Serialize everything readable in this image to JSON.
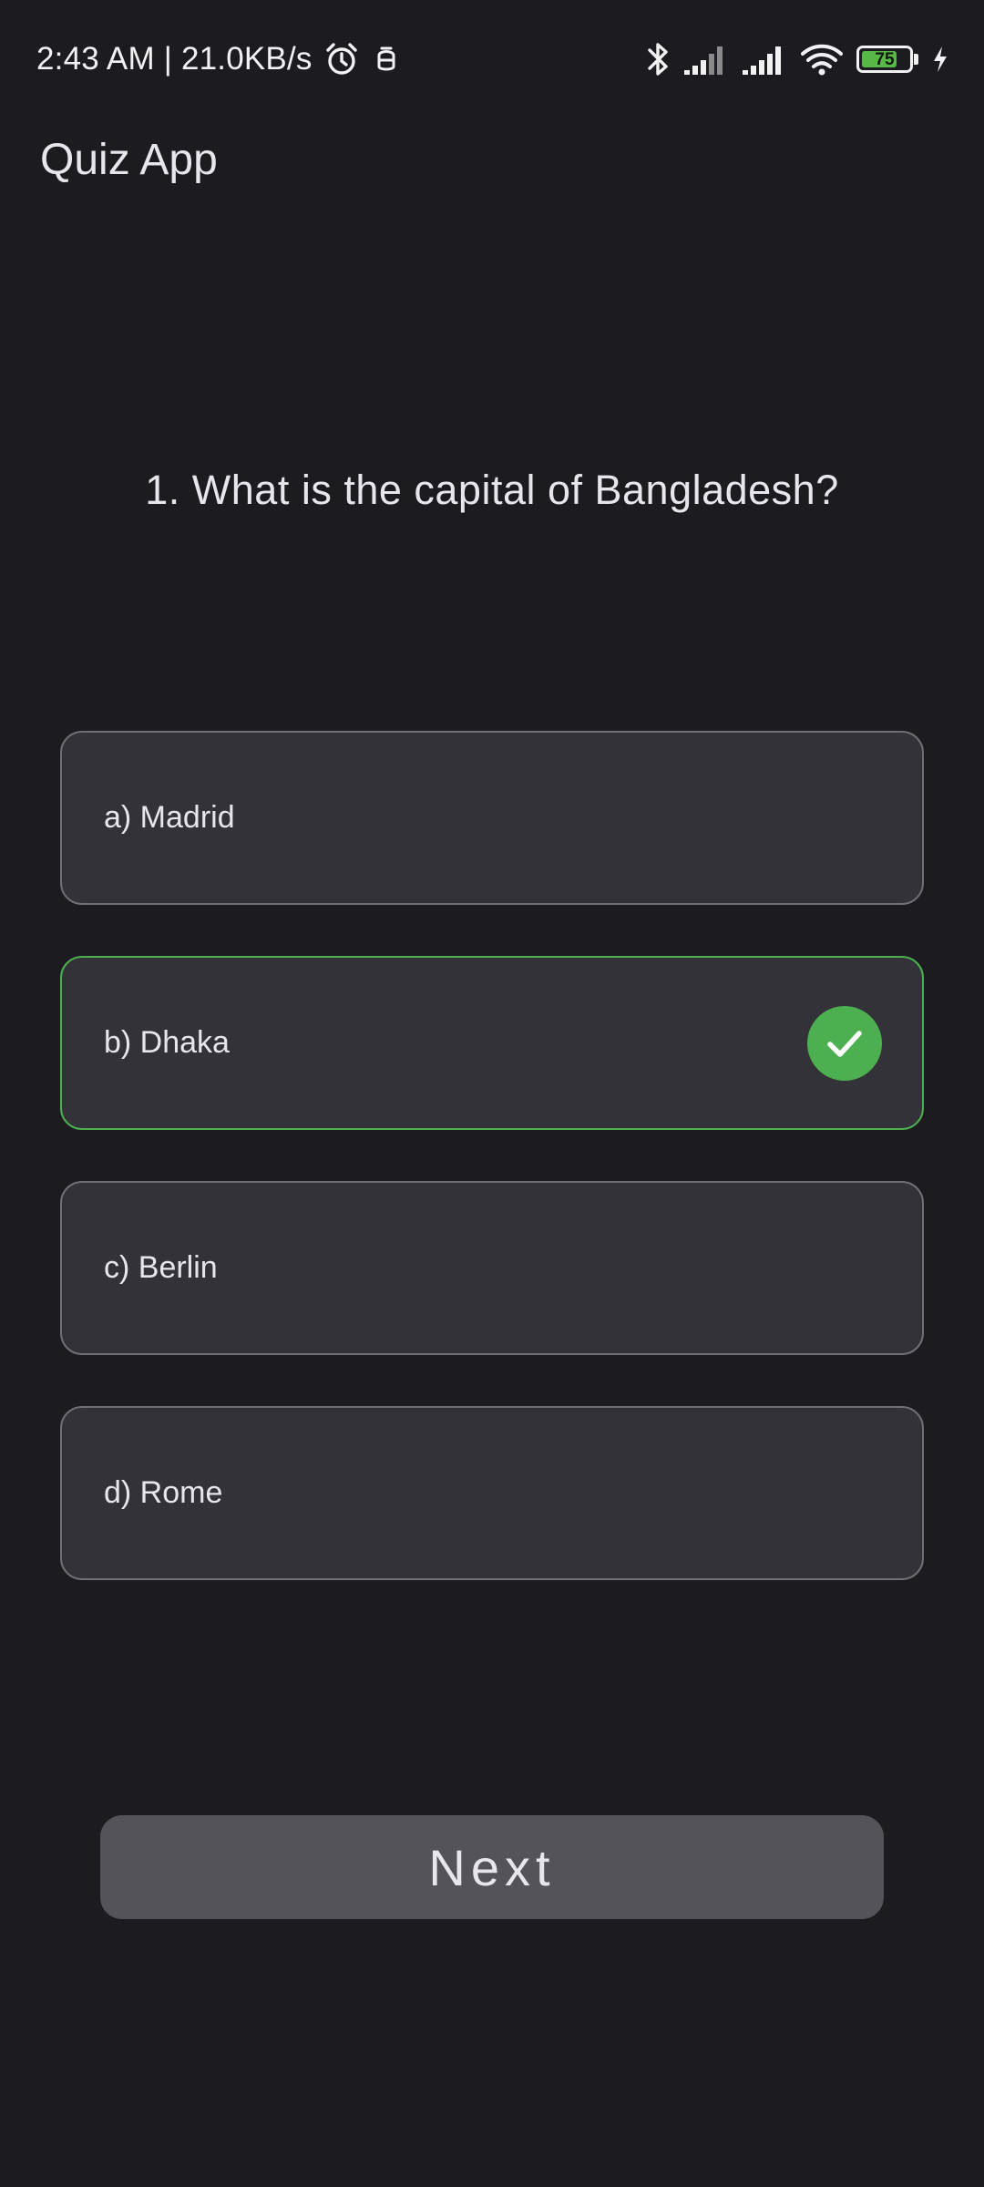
{
  "status_bar": {
    "text": "2:43 AM | 21.0KB/s",
    "battery_level": "75",
    "battery_fraction": 0.75,
    "icons_left": [
      "alarm-icon",
      "notification-icon"
    ],
    "icons_right": [
      "bluetooth-icon",
      "signal-icon",
      "signal-icon",
      "wifi-icon",
      "battery-icon",
      "charging-icon"
    ]
  },
  "app_bar": {
    "title": "Quiz App"
  },
  "quiz": {
    "question": "1. What is the capital of Bangladesh?",
    "options": [
      {
        "label": "a) Madrid",
        "selected": false
      },
      {
        "label": "b) Dhaka",
        "selected": true
      },
      {
        "label": "c) Berlin",
        "selected": false
      },
      {
        "label": "d) Rome",
        "selected": false
      }
    ],
    "next_label": "Next"
  },
  "colors": {
    "background": "#1c1b20",
    "card": "#333238",
    "card_border": "#6f6e74",
    "accent_correct": "#4caf50",
    "button": "#54535a",
    "battery": "#57b846"
  }
}
